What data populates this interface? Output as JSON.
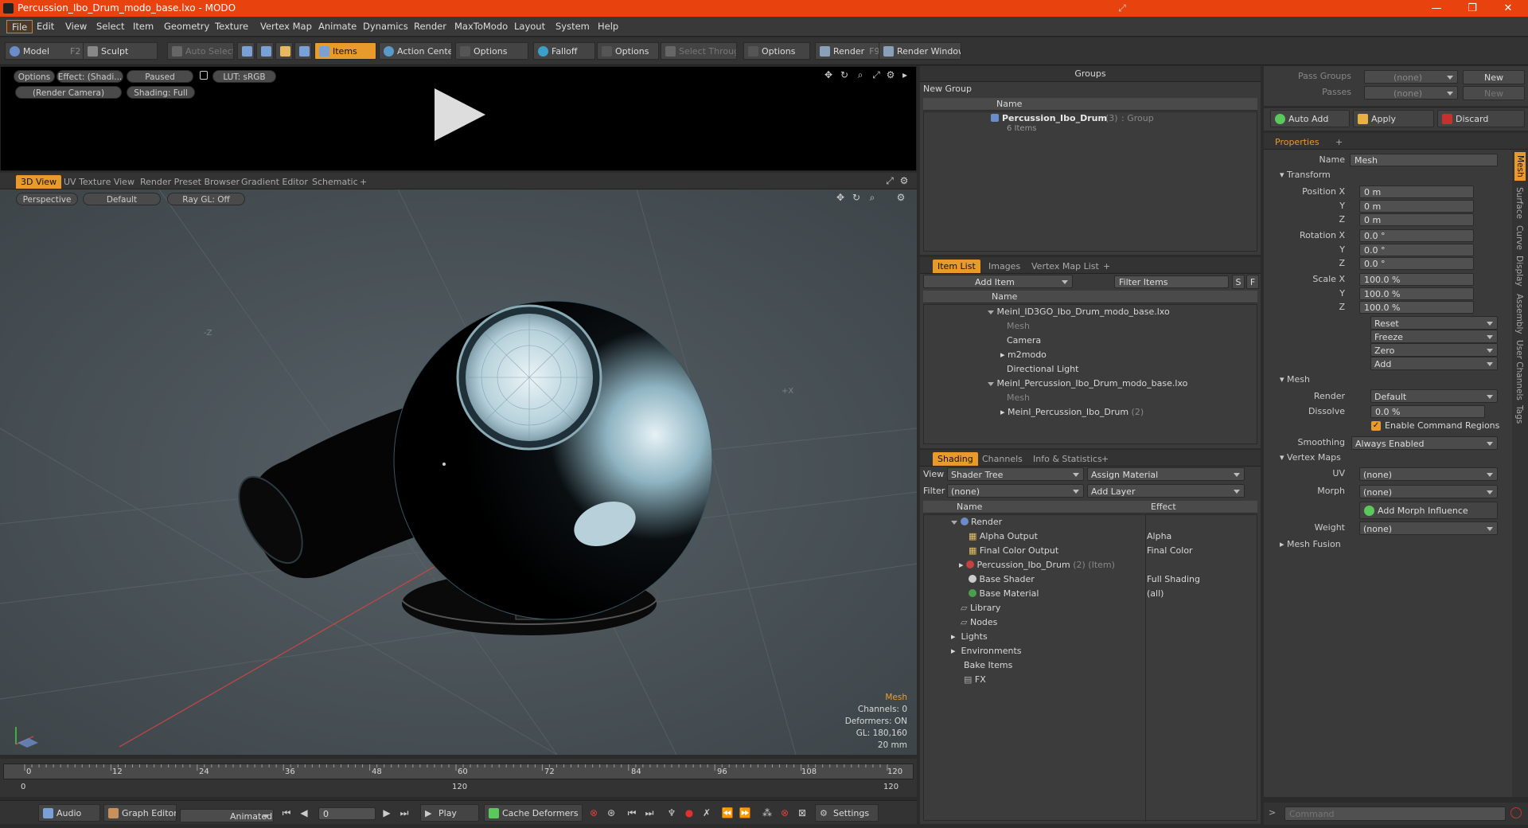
{
  "window": {
    "title": "Percussion_Ibo_Drum_modo_base.lxo - MODO",
    "controls": [
      "—",
      "❐",
      "✕"
    ]
  },
  "menu": [
    "File",
    "Edit",
    "View",
    "Select",
    "Item",
    "Geometry",
    "Texture",
    "Vertex Map",
    "Animate",
    "Dynamics",
    "Render",
    "MaxToModo",
    "Layout",
    "System",
    "Help"
  ],
  "toolbar": {
    "model": "Model",
    "model_key": "F2",
    "sculpt": "Sculpt",
    "auto_select": "Auto Select",
    "items": "Items",
    "action_center": "Action Center",
    "options1": "Options",
    "falloff": "Falloff",
    "options2": "Options",
    "select_through": "Select Through",
    "options3": "Options",
    "render": "Render",
    "render_key": "F9",
    "render_window": "Render Window"
  },
  "preview": {
    "options": "Options",
    "effect": "Effect: (Shadi...",
    "paused": "Paused",
    "lut": "LUT: sRGB",
    "camera": "(Render Camera)",
    "shading": "Shading: Full"
  },
  "viewport": {
    "tabs": [
      "3D View",
      "UV Texture View",
      "Render Preset Browser",
      "Gradient Editor",
      "Schematic"
    ],
    "projection": "Perspective",
    "style": "Default",
    "raygl": "Ray GL: Off",
    "axis_minus_z": "-Z",
    "axis_plus_x": "+X",
    "info": {
      "item": "Mesh",
      "channels": "Channels: 0",
      "deformers": "Deformers: ON",
      "gl": "GL: 180,160",
      "scale": "20 mm"
    }
  },
  "timeline": {
    "ticks": [
      "0",
      "12",
      "24",
      "36",
      "48",
      "60",
      "72",
      "84",
      "96",
      "108",
      "120"
    ],
    "bottom": [
      "0",
      "120",
      "120"
    ]
  },
  "transport": {
    "audio": "Audio",
    "graph_editor": "Graph Editor",
    "animated": "Animated",
    "frame": "0",
    "play": "Play",
    "cache_deformers": "Cache Deformers",
    "settings": "Settings"
  },
  "groups": {
    "title": "Groups",
    "new_group": "New Group",
    "col_name": "Name",
    "item_name": "Percussion_Ibo_Drum",
    "item_count": "(3)",
    "item_type": ": Group",
    "item_sub": "6 Items"
  },
  "itemlist": {
    "tabs": [
      "Item List",
      "Images",
      "Vertex Map List"
    ],
    "add_item": "Add Item",
    "filter": "Filter Items",
    "s": "S",
    "f": "F",
    "col_name": "Name",
    "rows": [
      {
        "label": "Meinl_ID3GO_Ibo_Drum_modo_base.lxo",
        "indent": 0,
        "dim": false
      },
      {
        "label": "Mesh",
        "indent": 1,
        "dim": true
      },
      {
        "label": "Camera",
        "indent": 1,
        "dim": false
      },
      {
        "label": "m2modo",
        "indent": 1,
        "dim": false
      },
      {
        "label": "Directional Light",
        "indent": 1,
        "dim": false
      },
      {
        "label": "Meinl_Percussion_Ibo_Drum_modo_base.lxo",
        "indent": 0,
        "dim": false
      },
      {
        "label": "Mesh",
        "indent": 1,
        "dim": true
      },
      {
        "label": "Meinl_Percussion_Ibo_Drum",
        "indent": 1,
        "dim": false,
        "suffix": "(2)"
      }
    ]
  },
  "shading": {
    "tabs": [
      "Shading",
      "Channels",
      "Info & Statistics"
    ],
    "view_label": "View",
    "view_value": "Shader Tree",
    "assign_material": "Assign Material",
    "filter_label": "Filter",
    "filter_value": "(none)",
    "add_layer": "Add Layer",
    "col_name": "Name",
    "col_effect": "Effect",
    "rows": [
      {
        "label": "Render",
        "effect": ""
      },
      {
        "label": "Alpha Output",
        "effect": "Alpha"
      },
      {
        "label": "Final Color Output",
        "effect": "Final Color"
      },
      {
        "label": "Percussion_Ibo_Drum",
        "effect": "",
        "suffix": "(2) (Item)"
      },
      {
        "label": "Base Shader",
        "effect": "Full Shading"
      },
      {
        "label": "Base Material",
        "effect": "(all)"
      },
      {
        "label": "Library",
        "effect": ""
      },
      {
        "label": "Nodes",
        "effect": ""
      },
      {
        "label": "Lights",
        "effect": ""
      },
      {
        "label": "Environments",
        "effect": ""
      },
      {
        "label": "Bake Items",
        "effect": ""
      },
      {
        "label": "FX",
        "effect": ""
      }
    ]
  },
  "passes": {
    "pass_groups": "Pass Groups",
    "passes": "Passes",
    "none": "(none)",
    "new": "New"
  },
  "actions": {
    "auto_add": "Auto Add",
    "apply": "Apply",
    "discard": "Discard"
  },
  "properties": {
    "tab": "Properties",
    "name_label": "Name",
    "name_value": "Mesh",
    "transform": "Transform",
    "position_x": "Position X",
    "y": "Y",
    "z": "Z",
    "zero_m": "0 m",
    "rotation_x": "Rotation X",
    "zero_deg": "0.0 °",
    "scale_x": "Scale X",
    "hundred": "100.0 %",
    "reset": "Reset",
    "freeze": "Freeze",
    "zero": "Zero",
    "add": "Add",
    "mesh": "Mesh",
    "render_label": "Render",
    "render_value": "Default",
    "dissolve_label": "Dissolve",
    "dissolve_value": "0.0 %",
    "enable_cmd": "Enable Command Regions",
    "smoothing_label": "Smoothing",
    "smoothing_value": "Always Enabled",
    "vertex_maps": "Vertex Maps",
    "uv_label": "UV",
    "morph_label": "Morph",
    "weight_label": "Weight",
    "none": "(none)",
    "add_morph": "Add Morph Influence",
    "mesh_fusion": "Mesh Fusion",
    "side_tabs": [
      "Mesh",
      "Surface",
      "Curve",
      "Display",
      "Assembly",
      "User Channels",
      "Tags"
    ]
  },
  "command": {
    "placeholder": "Command"
  }
}
